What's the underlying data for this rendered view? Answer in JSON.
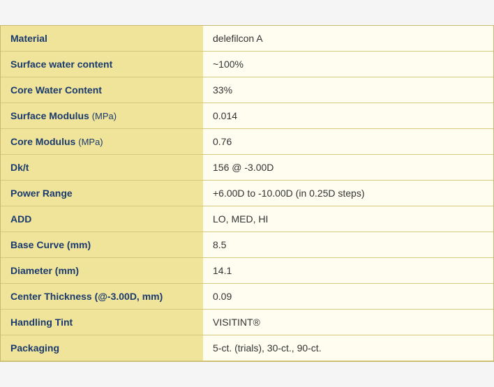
{
  "table": {
    "rows": [
      {
        "label": "Material",
        "label_unit": "",
        "value": "delefilcon A"
      },
      {
        "label": "Surface water content",
        "label_unit": "",
        "value": "~100%"
      },
      {
        "label": "Core Water Content",
        "label_unit": "",
        "value": "33%"
      },
      {
        "label": "Surface Modulus",
        "label_unit": "(MPa)",
        "value": "0.014"
      },
      {
        "label": "Core Modulus",
        "label_unit": "(MPa)",
        "value": "0.76"
      },
      {
        "label": "Dk/t",
        "label_unit": "",
        "value": "156 @ -3.00D"
      },
      {
        "label": "Power Range",
        "label_unit": "",
        "value": "+6.00D to -10.00D (in 0.25D steps)"
      },
      {
        "label": "ADD",
        "label_unit": "",
        "value": "LO, MED, HI"
      },
      {
        "label": "Base Curve (mm)",
        "label_unit": "",
        "value": "8.5"
      },
      {
        "label": "Diameter (mm)",
        "label_unit": "",
        "value": "14.1"
      },
      {
        "label": "Center Thickness (@-3.00D, mm)",
        "label_unit": "",
        "value": "0.09"
      },
      {
        "label": "Handling Tint",
        "label_unit": "",
        "value": "VISITINT®"
      },
      {
        "label": "Packaging",
        "label_unit": "",
        "value": "5-ct. (trials), 30-ct., 90-ct."
      }
    ]
  }
}
